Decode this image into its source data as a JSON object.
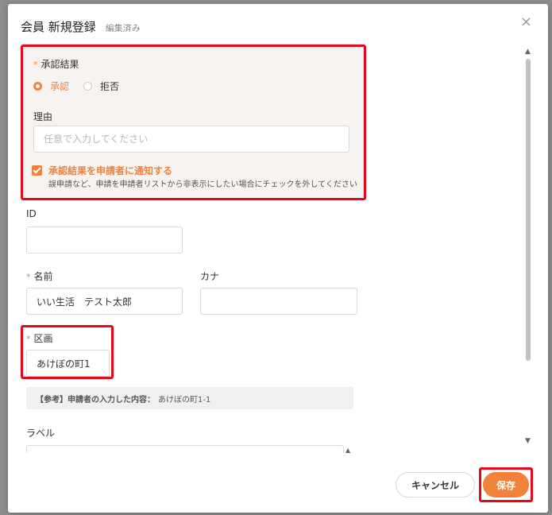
{
  "modal": {
    "title": "会員 新規登録",
    "status": "編集済み",
    "close_icon": "×"
  },
  "approval": {
    "label": "承認結果",
    "options": [
      "承認",
      "拒否"
    ],
    "selected": "承認",
    "reason_label": "理由",
    "reason_placeholder": "任意で入力してください",
    "reason_value": "",
    "notify_label": "承認結果を申請者に通知する",
    "notify_checked": true,
    "notify_description": "誤申請など、申請を申請者リストから非表示にしたい場合にチェックを外してください"
  },
  "fields": {
    "id_label": "ID",
    "id_value": "",
    "name_label": "名前",
    "name_value": "いい生活　テスト太郎",
    "kana_label": "カナ",
    "kana_value": "",
    "district_label": "区画",
    "district_value": "あけぼの町1",
    "reference_prefix": "【参考】申請者の入力した内容：",
    "reference_value": "あけぼの町1-1",
    "label_label": "ラベル"
  },
  "footer": {
    "cancel_label": "キャンセル",
    "save_label": "保存"
  },
  "colors": {
    "accent": "#f0823c",
    "highlight": "#e8071a"
  }
}
